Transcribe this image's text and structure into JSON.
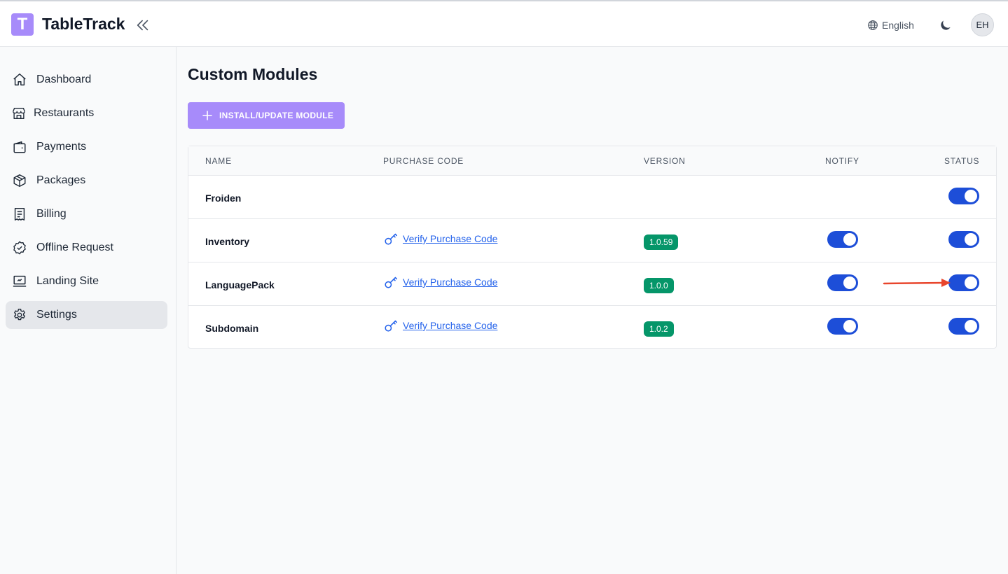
{
  "header": {
    "logo_letter": "T",
    "brand": "TableTrack",
    "language": "English",
    "avatar_initials": "EH",
    "brand_color": "#a78bfa"
  },
  "sidebar": {
    "items": [
      {
        "label": "Dashboard",
        "icon": "home-icon"
      },
      {
        "label": "Restaurants",
        "icon": "store-icon"
      },
      {
        "label": "Payments",
        "icon": "wallet-icon"
      },
      {
        "label": "Packages",
        "icon": "package-icon"
      },
      {
        "label": "Billing",
        "icon": "receipt-icon"
      },
      {
        "label": "Offline Request",
        "icon": "badge-check-icon"
      },
      {
        "label": "Landing Site",
        "icon": "monitor-icon"
      },
      {
        "label": "Settings",
        "icon": "gear-icon",
        "active": true
      }
    ]
  },
  "main": {
    "title": "Custom Modules",
    "install_button": "INSTALL/UPDATE MODULE",
    "table": {
      "headers": {
        "name": "NAME",
        "purchase_code": "PURCHASE CODE",
        "version": "VERSION",
        "notify": "NOTIFY",
        "status": "STATUS"
      },
      "rows": [
        {
          "name": "Froiden",
          "purchase_code": "",
          "version": "",
          "notify": null,
          "status": true
        },
        {
          "name": "Inventory",
          "purchase_code": "Verify Purchase Code",
          "version": "1.0.59",
          "notify": true,
          "status": true
        },
        {
          "name": "LanguagePack",
          "purchase_code": "Verify Purchase Code",
          "version": "1.0.0",
          "notify": true,
          "status": true
        },
        {
          "name": "Subdomain",
          "purchase_code": "Verify Purchase Code",
          "version": "1.0.2",
          "notify": true,
          "status": true
        }
      ]
    }
  },
  "colors": {
    "toggle_on": "#1d4ed8",
    "version_badge": "#059669",
    "link": "#2563eb",
    "annotation_arrow": "#e8452c"
  }
}
